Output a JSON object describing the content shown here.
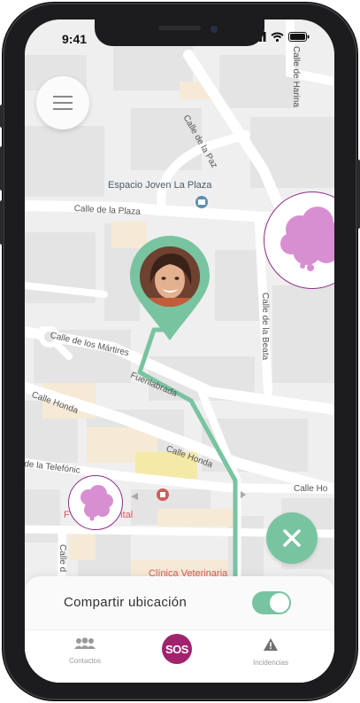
{
  "status_bar": {
    "time": "9:41"
  },
  "map": {
    "streets": {
      "calle_de_harina": "Calle de Harina",
      "calle_de_la_paz": "Calle de la Paz",
      "calle_de_la_plaza": "Calle de la Plaza",
      "calle_de_la_beata": "Calle de la Beata",
      "calle_de_los_martires": "Calle de los Mártires",
      "fuenlabrada": "Fuenlabrada",
      "calle_honda_1": "Calle Honda",
      "calle_honda_2": "Calle Honda",
      "calle_honda_3": "Calle Ho",
      "calle_telefonica": "de la Telefónic",
      "calle_vertical": "Calle d"
    },
    "pois": {
      "espacio_joven": "Espacio Joven La Plaza",
      "clinica_dental": "F        Clínica Dental",
      "clinica_veterinaria": "Clínica Veterinaria"
    },
    "route_color": "#78c4a0",
    "blob_color": "#d88fd2",
    "pin_color": "#78c4a0"
  },
  "share": {
    "label": "Compartir ubicación",
    "enabled": true
  },
  "tabs": {
    "contactos": "Contactos",
    "sos": "SOS",
    "incidencias": "Incidencias"
  },
  "colors": {
    "accent": "#78c4a0",
    "sos": "#a0236e",
    "blob_border": "#8e2a86"
  },
  "icons": {
    "menu": "menu-icon",
    "close": "close-icon",
    "contacts": "contacts-icon",
    "incidents": "warning-icon",
    "poi": "museum-icon",
    "clinic": "clinic-icon"
  }
}
